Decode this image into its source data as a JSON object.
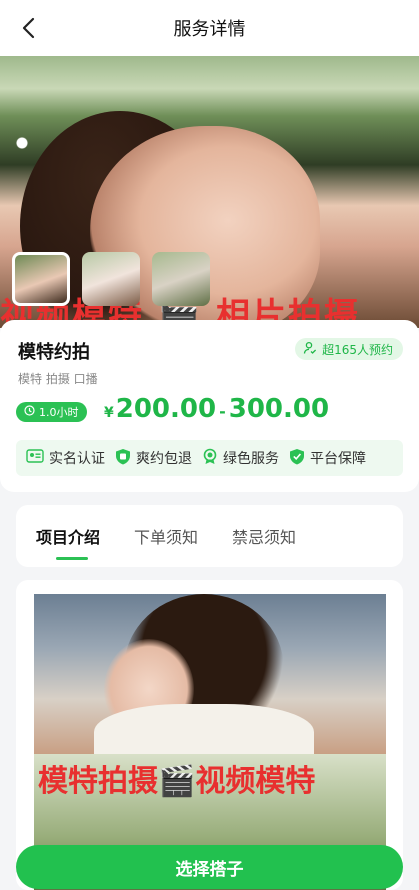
{
  "nav": {
    "title": "服务详情"
  },
  "hero": {
    "overlay_text": "视频模特 🎬 相片拍摄"
  },
  "service": {
    "name": "模特约拍",
    "booked": "超165人预约",
    "tags": "模特 拍摄 口播",
    "duration": "1.0小时",
    "currency": "¥",
    "price_min": "200.00",
    "price_sep": "-",
    "price_max": "300.00",
    "guarantees": [
      {
        "label": "实名认证",
        "icon": "id-card-icon"
      },
      {
        "label": "爽约包退",
        "icon": "refund-shield-icon"
      },
      {
        "label": "绿色服务",
        "icon": "badge-icon"
      },
      {
        "label": "平台保障",
        "icon": "check-shield-icon"
      }
    ]
  },
  "tabs": [
    "项目介绍",
    "下单须知",
    "禁忌须知"
  ],
  "detail": {
    "image_text": "模特拍摄🎬视频模特"
  },
  "cta": {
    "label": "选择搭子"
  },
  "colors": {
    "accent": "#22c14f",
    "accent_light": "#eef9f0",
    "overlay_red": "#e8302f"
  }
}
